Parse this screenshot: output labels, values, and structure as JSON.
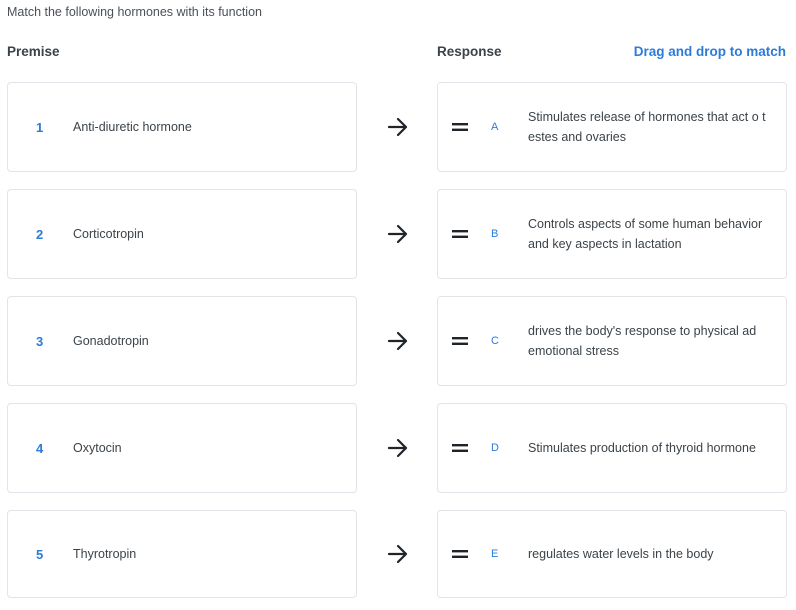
{
  "question": "Match the following hormones with its function",
  "headers": {
    "premise": "Premise",
    "response": "Response",
    "hint": "Drag and drop to match"
  },
  "premises": [
    {
      "number": "1",
      "text": "Anti-diuretic hormone"
    },
    {
      "number": "2",
      "text": "Corticotropin"
    },
    {
      "number": "3",
      "text": "Gonadotropin"
    },
    {
      "number": "4",
      "text": "Oxytocin"
    },
    {
      "number": "5",
      "text": "Thyrotropin"
    }
  ],
  "responses": [
    {
      "letter": "A",
      "text": "Stimulates release of hormones that act o testes and ovaries"
    },
    {
      "letter": "B",
      "text": "Controls aspects of some human behavior and key aspects in lactation"
    },
    {
      "letter": "C",
      "text": "drives the body's response to physical ad emotional stress"
    },
    {
      "letter": "D",
      "text": "Stimulates production of thyroid hormone"
    },
    {
      "letter": "E",
      "text": "regulates water levels in the body"
    }
  ],
  "colors": {
    "accent": "#2b7bd9",
    "text": "#3b4349",
    "border": "#e1e4e8"
  },
  "icons": {
    "arrow": "arrow-right-icon",
    "handle": "drag-handle-icon"
  }
}
